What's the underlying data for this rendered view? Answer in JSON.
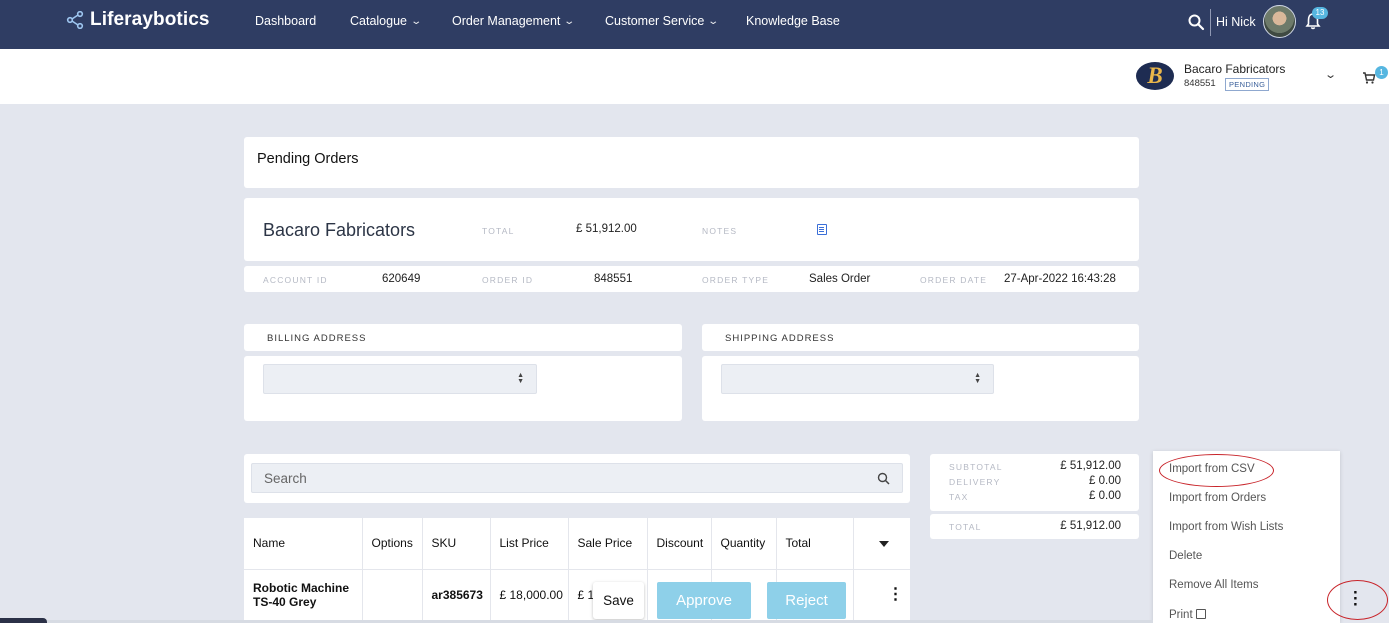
{
  "nav": {
    "brand": "Liferaybotics",
    "links": [
      {
        "label": "Dashboard",
        "has_dropdown": false
      },
      {
        "label": "Catalogue",
        "has_dropdown": true
      },
      {
        "label": "Order Management",
        "has_dropdown": true
      },
      {
        "label": "Customer Service",
        "has_dropdown": true
      },
      {
        "label": "Knowledge Base",
        "has_dropdown": false
      }
    ],
    "greeting": "Hi Nick",
    "notification_count": "13",
    "icons": [
      "share-icon",
      "search-icon",
      "bell-icon",
      "avatar"
    ]
  },
  "account": {
    "logo_letter": "B",
    "name": "Bacaro Fabricators",
    "order_number": "848551",
    "status": "PENDING",
    "cart_count": "1"
  },
  "page": {
    "title": "Pending Orders"
  },
  "order": {
    "company": "Bacaro Fabricators",
    "total_label": "TOTAL",
    "total_value": "£ 51,912.00",
    "notes_label": "NOTES",
    "account_id_label": "ACCOUNT ID",
    "account_id": "620649",
    "order_id_label": "ORDER ID",
    "order_id": "848551",
    "order_type_label": "ORDER TYPE",
    "order_type": "Sales Order",
    "order_date_label": "ORDER DATE",
    "order_date": "27-Apr-2022 16:43:28"
  },
  "addresses": {
    "billing_label": "BILLING ADDRESS",
    "shipping_label": "SHIPPING ADDRESS"
  },
  "search": {
    "placeholder": "Search"
  },
  "table": {
    "headers": [
      "Name",
      "Options",
      "SKU",
      "List Price",
      "Sale Price",
      "Discount",
      "Quantity",
      "Total"
    ],
    "rows": [
      {
        "name_line1": "Robotic Machine",
        "name_line2": "TS-40 Grey",
        "options": "",
        "sku": "ar385673",
        "list_price": "£ 18,000.00",
        "sale_price": "£ 1"
      }
    ]
  },
  "actions": {
    "save": "Save",
    "approve": "Approve",
    "reject": "Reject"
  },
  "summary": {
    "subtotal_label": "SUBTOTAL",
    "subtotal": "£ 51,912.00",
    "delivery_label": "DELIVERY",
    "delivery": "£ 0.00",
    "tax_label": "TAX",
    "tax": "£ 0.00",
    "total_label": "TOTAL",
    "total": "£ 51,912.00"
  },
  "menu": {
    "items": [
      "Import from CSV",
      "Import from Orders",
      "Import from Wish Lists",
      "Delete",
      "Remove All Items",
      "Print"
    ]
  },
  "colors": {
    "nav": "#2f3d63",
    "accent": "#8ed0e9",
    "badge": "#56b6e0",
    "annotation": "#c8242a"
  }
}
